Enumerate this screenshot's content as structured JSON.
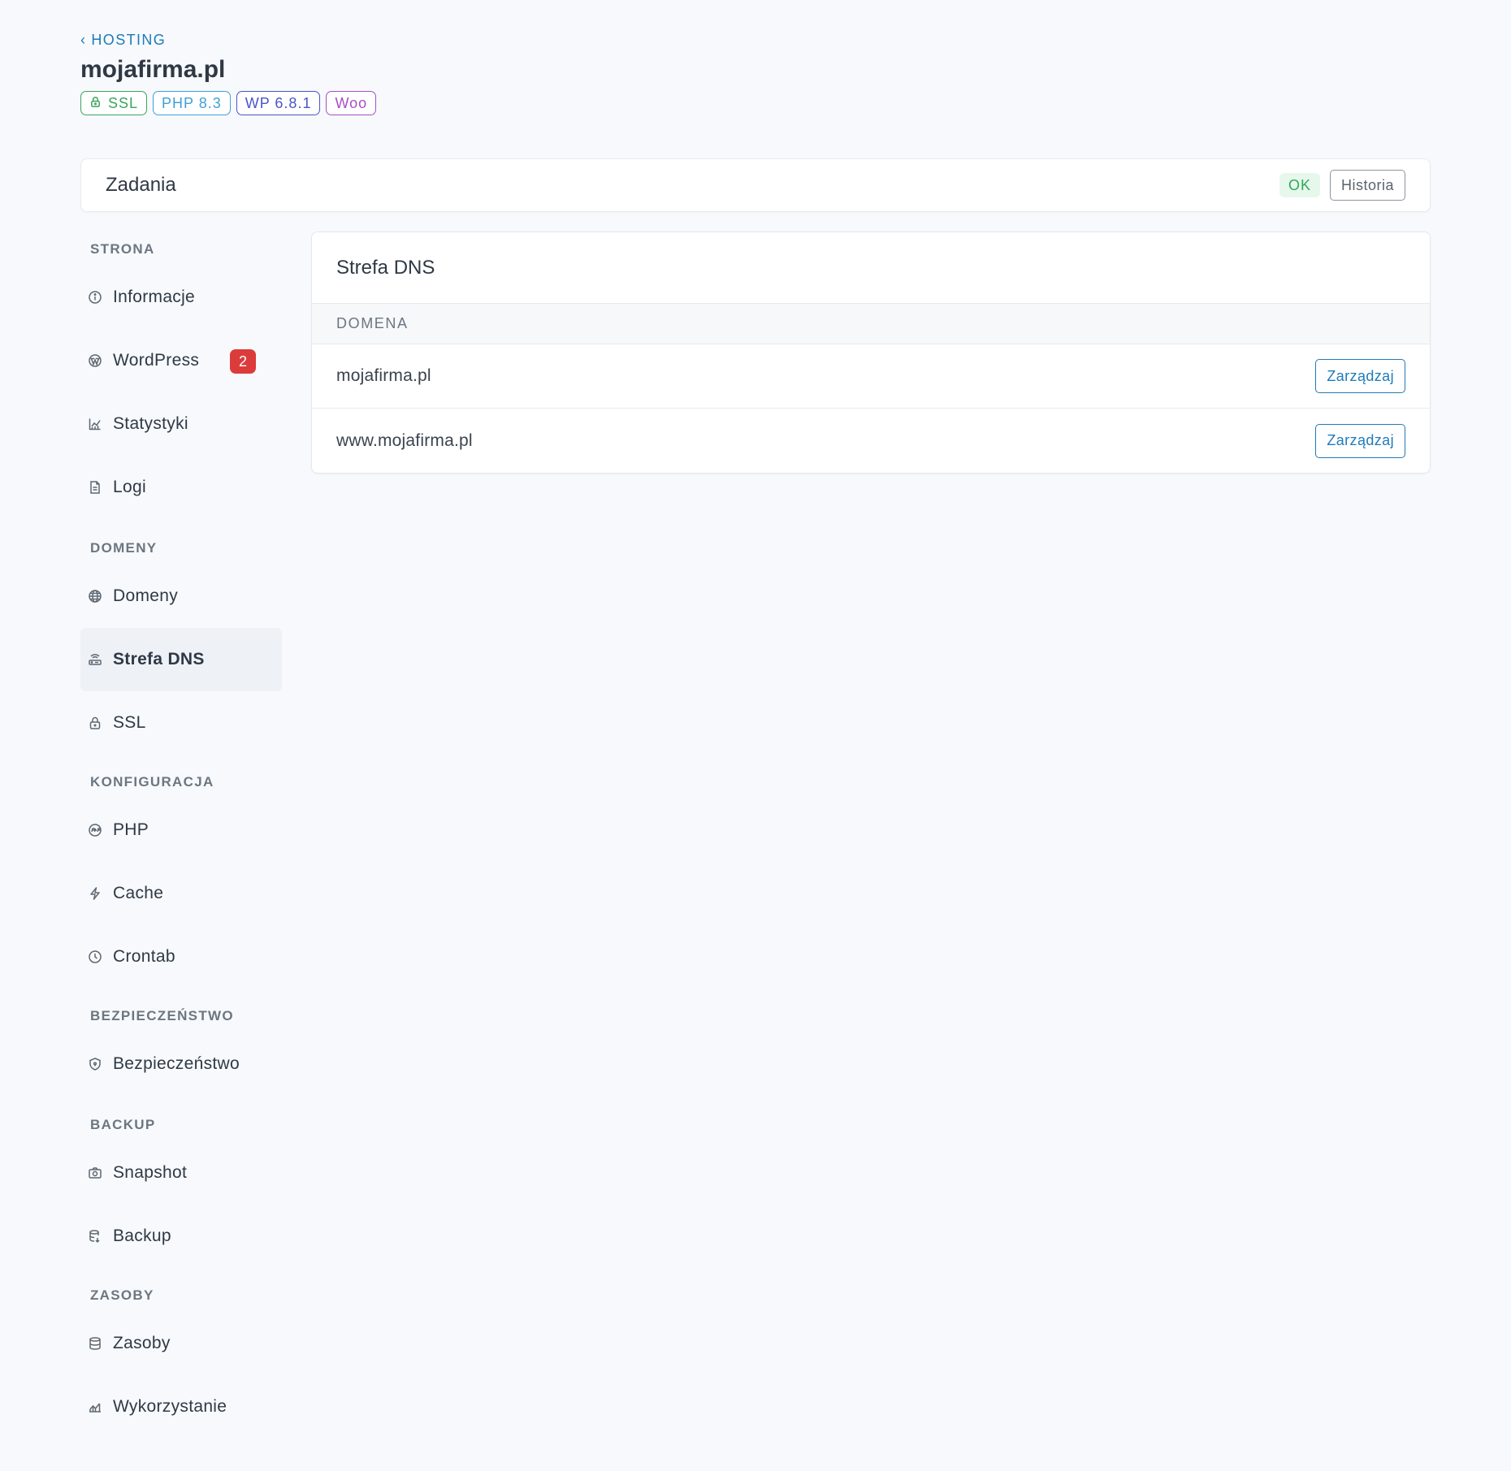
{
  "header": {
    "back_label": "HOSTING",
    "title": "mojafirma.pl",
    "badges": [
      {
        "label": "SSL",
        "color": "#3aa55c",
        "icon": "lock-icon"
      },
      {
        "label": "PHP 8.3",
        "color": "#3ea0d6"
      },
      {
        "label": "WP 6.8.1",
        "color": "#4a55c9"
      },
      {
        "label": "Woo",
        "color": "#a84fc2"
      }
    ]
  },
  "tasks": {
    "title": "Zadania",
    "status": "OK",
    "history_label": "Historia"
  },
  "sidebar": {
    "sections": [
      {
        "label": "STRONA",
        "items": [
          {
            "label": "Informacje",
            "icon": "info-icon"
          },
          {
            "label": "WordPress",
            "icon": "wordpress-icon",
            "count": "2"
          },
          {
            "label": "Statystyki",
            "icon": "chart-icon"
          },
          {
            "label": "Logi",
            "icon": "file-icon"
          }
        ]
      },
      {
        "label": "DOMENY",
        "items": [
          {
            "label": "Domeny",
            "icon": "globe-icon"
          },
          {
            "label": "Strefa DNS",
            "icon": "router-icon",
            "active": true
          },
          {
            "label": "SSL",
            "icon": "lock-icon"
          }
        ]
      },
      {
        "label": "KONFIGURACJA",
        "items": [
          {
            "label": "PHP",
            "icon": "php-icon"
          },
          {
            "label": "Cache",
            "icon": "bolt-icon"
          },
          {
            "label": "Crontab",
            "icon": "clock-icon"
          }
        ]
      },
      {
        "label": "BEZPIECZEŃSTWO",
        "items": [
          {
            "label": "Bezpieczeństwo",
            "icon": "shield-icon"
          }
        ]
      },
      {
        "label": "BACKUP",
        "items": [
          {
            "label": "Snapshot",
            "icon": "camera-icon"
          },
          {
            "label": "Backup",
            "icon": "database-restore-icon"
          }
        ]
      },
      {
        "label": "ZASOBY",
        "items": [
          {
            "label": "Zasoby",
            "icon": "database-icon"
          },
          {
            "label": "Wykorzystanie",
            "icon": "usage-chart-icon"
          }
        ]
      }
    ]
  },
  "dns": {
    "title": "Strefa DNS",
    "column_header": "DOMENA",
    "rows": [
      {
        "domain": "mojafirma.pl",
        "action": "Zarządzaj"
      },
      {
        "domain": "www.mojafirma.pl",
        "action": "Zarządzaj"
      }
    ]
  }
}
